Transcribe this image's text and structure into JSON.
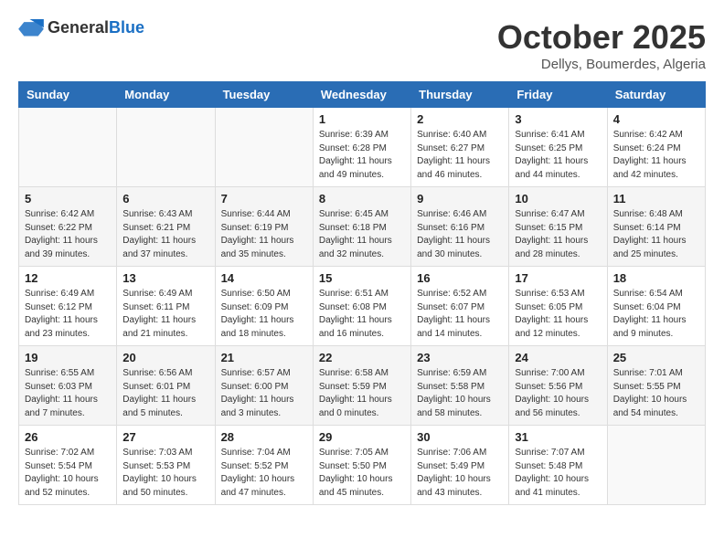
{
  "header": {
    "logo_general": "General",
    "logo_blue": "Blue",
    "month_title": "October 2025",
    "location": "Dellys, Boumerdes, Algeria"
  },
  "weekdays": [
    "Sunday",
    "Monday",
    "Tuesday",
    "Wednesday",
    "Thursday",
    "Friday",
    "Saturday"
  ],
  "weeks": [
    [
      {
        "day": "",
        "info": ""
      },
      {
        "day": "",
        "info": ""
      },
      {
        "day": "",
        "info": ""
      },
      {
        "day": "1",
        "info": "Sunrise: 6:39 AM\nSunset: 6:28 PM\nDaylight: 11 hours\nand 49 minutes."
      },
      {
        "day": "2",
        "info": "Sunrise: 6:40 AM\nSunset: 6:27 PM\nDaylight: 11 hours\nand 46 minutes."
      },
      {
        "day": "3",
        "info": "Sunrise: 6:41 AM\nSunset: 6:25 PM\nDaylight: 11 hours\nand 44 minutes."
      },
      {
        "day": "4",
        "info": "Sunrise: 6:42 AM\nSunset: 6:24 PM\nDaylight: 11 hours\nand 42 minutes."
      }
    ],
    [
      {
        "day": "5",
        "info": "Sunrise: 6:42 AM\nSunset: 6:22 PM\nDaylight: 11 hours\nand 39 minutes."
      },
      {
        "day": "6",
        "info": "Sunrise: 6:43 AM\nSunset: 6:21 PM\nDaylight: 11 hours\nand 37 minutes."
      },
      {
        "day": "7",
        "info": "Sunrise: 6:44 AM\nSunset: 6:19 PM\nDaylight: 11 hours\nand 35 minutes."
      },
      {
        "day": "8",
        "info": "Sunrise: 6:45 AM\nSunset: 6:18 PM\nDaylight: 11 hours\nand 32 minutes."
      },
      {
        "day": "9",
        "info": "Sunrise: 6:46 AM\nSunset: 6:16 PM\nDaylight: 11 hours\nand 30 minutes."
      },
      {
        "day": "10",
        "info": "Sunrise: 6:47 AM\nSunset: 6:15 PM\nDaylight: 11 hours\nand 28 minutes."
      },
      {
        "day": "11",
        "info": "Sunrise: 6:48 AM\nSunset: 6:14 PM\nDaylight: 11 hours\nand 25 minutes."
      }
    ],
    [
      {
        "day": "12",
        "info": "Sunrise: 6:49 AM\nSunset: 6:12 PM\nDaylight: 11 hours\nand 23 minutes."
      },
      {
        "day": "13",
        "info": "Sunrise: 6:49 AM\nSunset: 6:11 PM\nDaylight: 11 hours\nand 21 minutes."
      },
      {
        "day": "14",
        "info": "Sunrise: 6:50 AM\nSunset: 6:09 PM\nDaylight: 11 hours\nand 18 minutes."
      },
      {
        "day": "15",
        "info": "Sunrise: 6:51 AM\nSunset: 6:08 PM\nDaylight: 11 hours\nand 16 minutes."
      },
      {
        "day": "16",
        "info": "Sunrise: 6:52 AM\nSunset: 6:07 PM\nDaylight: 11 hours\nand 14 minutes."
      },
      {
        "day": "17",
        "info": "Sunrise: 6:53 AM\nSunset: 6:05 PM\nDaylight: 11 hours\nand 12 minutes."
      },
      {
        "day": "18",
        "info": "Sunrise: 6:54 AM\nSunset: 6:04 PM\nDaylight: 11 hours\nand 9 minutes."
      }
    ],
    [
      {
        "day": "19",
        "info": "Sunrise: 6:55 AM\nSunset: 6:03 PM\nDaylight: 11 hours\nand 7 minutes."
      },
      {
        "day": "20",
        "info": "Sunrise: 6:56 AM\nSunset: 6:01 PM\nDaylight: 11 hours\nand 5 minutes."
      },
      {
        "day": "21",
        "info": "Sunrise: 6:57 AM\nSunset: 6:00 PM\nDaylight: 11 hours\nand 3 minutes."
      },
      {
        "day": "22",
        "info": "Sunrise: 6:58 AM\nSunset: 5:59 PM\nDaylight: 11 hours\nand 0 minutes."
      },
      {
        "day": "23",
        "info": "Sunrise: 6:59 AM\nSunset: 5:58 PM\nDaylight: 10 hours\nand 58 minutes."
      },
      {
        "day": "24",
        "info": "Sunrise: 7:00 AM\nSunset: 5:56 PM\nDaylight: 10 hours\nand 56 minutes."
      },
      {
        "day": "25",
        "info": "Sunrise: 7:01 AM\nSunset: 5:55 PM\nDaylight: 10 hours\nand 54 minutes."
      }
    ],
    [
      {
        "day": "26",
        "info": "Sunrise: 7:02 AM\nSunset: 5:54 PM\nDaylight: 10 hours\nand 52 minutes."
      },
      {
        "day": "27",
        "info": "Sunrise: 7:03 AM\nSunset: 5:53 PM\nDaylight: 10 hours\nand 50 minutes."
      },
      {
        "day": "28",
        "info": "Sunrise: 7:04 AM\nSunset: 5:52 PM\nDaylight: 10 hours\nand 47 minutes."
      },
      {
        "day": "29",
        "info": "Sunrise: 7:05 AM\nSunset: 5:50 PM\nDaylight: 10 hours\nand 45 minutes."
      },
      {
        "day": "30",
        "info": "Sunrise: 7:06 AM\nSunset: 5:49 PM\nDaylight: 10 hours\nand 43 minutes."
      },
      {
        "day": "31",
        "info": "Sunrise: 7:07 AM\nSunset: 5:48 PM\nDaylight: 10 hours\nand 41 minutes."
      },
      {
        "day": "",
        "info": ""
      }
    ]
  ]
}
